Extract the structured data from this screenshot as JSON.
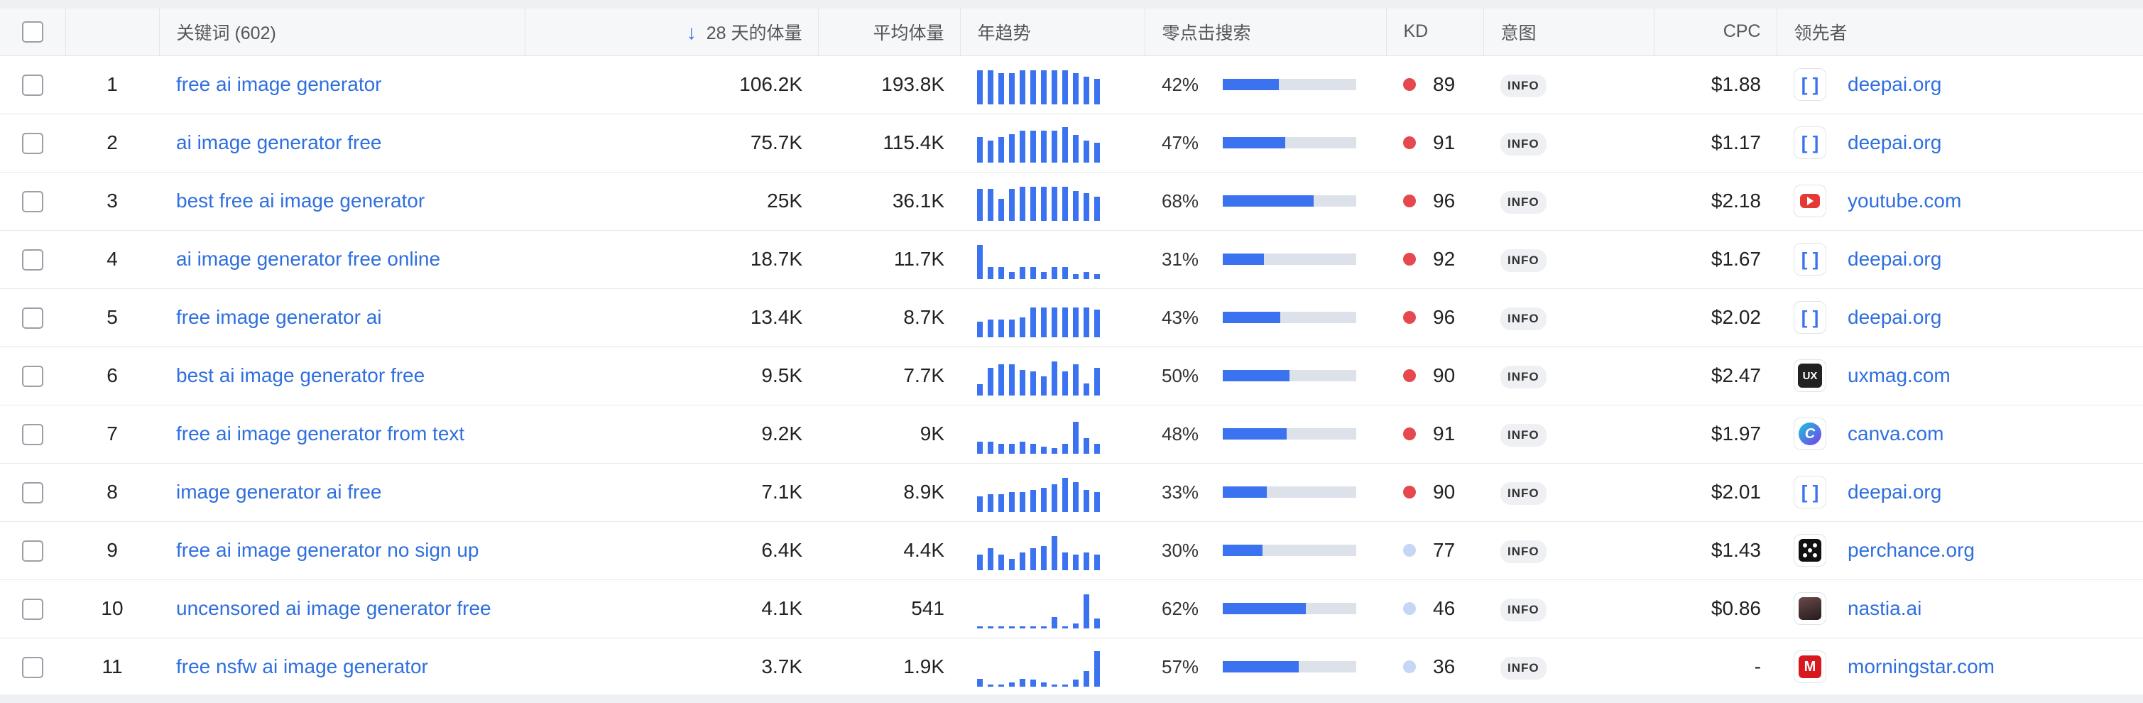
{
  "header": {
    "keyword": "关键词 (602)",
    "volume28": "28 天的体量",
    "avg_volume": "平均体量",
    "trend": "年趋势",
    "zero_click": "零点击搜索",
    "kd": "KD",
    "intent": "意图",
    "cpc": "CPC",
    "leader": "领先者"
  },
  "colors": {
    "accent": "#2f6fde",
    "bar": "#3a72f0",
    "kd_hard": "#e5484d",
    "kd_easy": "#c6d6f5"
  },
  "rows": [
    {
      "num": "1",
      "keyword": "free ai image generator",
      "vol28": "106.2K",
      "avg": "193.8K",
      "trend": [
        0.85,
        0.85,
        0.78,
        0.78,
        0.85,
        0.85,
        0.85,
        0.85,
        0.85,
        0.78,
        0.7,
        0.65
      ],
      "zero_pct": "42%",
      "zero": 0.42,
      "kd": "89",
      "kd_color": "#e5484d",
      "intent": "INFO",
      "cpc": "$1.88",
      "leader": "deepai.org",
      "leader_icon": "deepai-icon"
    },
    {
      "num": "2",
      "keyword": "ai image generator free",
      "vol28": "75.7K",
      "avg": "115.4K",
      "trend": [
        0.65,
        0.55,
        0.65,
        0.72,
        0.8,
        0.8,
        0.8,
        0.8,
        0.9,
        0.7,
        0.55,
        0.5
      ],
      "zero_pct": "47%",
      "zero": 0.47,
      "kd": "91",
      "kd_color": "#e5484d",
      "intent": "INFO",
      "cpc": "$1.17",
      "leader": "deepai.org",
      "leader_icon": "deepai-icon"
    },
    {
      "num": "3",
      "keyword": "best free ai image generator",
      "vol28": "25K",
      "avg": "36.1K",
      "trend": [
        0.8,
        0.8,
        0.55,
        0.8,
        0.85,
        0.85,
        0.85,
        0.85,
        0.85,
        0.75,
        0.7,
        0.6
      ],
      "zero_pct": "68%",
      "zero": 0.68,
      "kd": "96",
      "kd_color": "#e5484d",
      "intent": "INFO",
      "cpc": "$2.18",
      "leader": "youtube.com",
      "leader_icon": "youtube-icon"
    },
    {
      "num": "4",
      "keyword": "ai image generator free online",
      "vol28": "18.7K",
      "avg": "11.7K",
      "trend": [
        0.85,
        0.3,
        0.3,
        0.18,
        0.3,
        0.3,
        0.18,
        0.3,
        0.3,
        0.12,
        0.18,
        0.12
      ],
      "zero_pct": "31%",
      "zero": 0.31,
      "kd": "92",
      "kd_color": "#e5484d",
      "intent": "INFO",
      "cpc": "$1.67",
      "leader": "deepai.org",
      "leader_icon": "deepai-icon"
    },
    {
      "num": "5",
      "keyword": "free image generator ai",
      "vol28": "13.4K",
      "avg": "8.7K",
      "trend": [
        0.4,
        0.45,
        0.45,
        0.45,
        0.5,
        0.75,
        0.75,
        0.75,
        0.75,
        0.75,
        0.75,
        0.7
      ],
      "zero_pct": "43%",
      "zero": 0.43,
      "kd": "96",
      "kd_color": "#e5484d",
      "intent": "INFO",
      "cpc": "$2.02",
      "leader": "deepai.org",
      "leader_icon": "deepai-icon"
    },
    {
      "num": "6",
      "keyword": "best ai image generator free",
      "vol28": "9.5K",
      "avg": "7.7K",
      "trend": [
        0.28,
        0.7,
        0.78,
        0.78,
        0.65,
        0.6,
        0.48,
        0.85,
        0.6,
        0.78,
        0.3,
        0.7
      ],
      "zero_pct": "50%",
      "zero": 0.5,
      "kd": "90",
      "kd_color": "#e5484d",
      "intent": "INFO",
      "cpc": "$2.47",
      "leader": "uxmag.com",
      "leader_icon": "uxmag-icon"
    },
    {
      "num": "7",
      "keyword": "free ai image generator from text",
      "vol28": "9.2K",
      "avg": "9K",
      "trend": [
        0.3,
        0.3,
        0.25,
        0.25,
        0.3,
        0.25,
        0.18,
        0.15,
        0.25,
        0.8,
        0.4,
        0.25
      ],
      "zero_pct": "48%",
      "zero": 0.48,
      "kd": "91",
      "kd_color": "#e5484d",
      "intent": "INFO",
      "cpc": "$1.97",
      "leader": "canva.com",
      "leader_icon": "canva-icon"
    },
    {
      "num": "8",
      "keyword": "image generator ai free",
      "vol28": "7.1K",
      "avg": "8.9K",
      "trend": [
        0.4,
        0.45,
        0.45,
        0.5,
        0.5,
        0.55,
        0.6,
        0.7,
        0.85,
        0.75,
        0.55,
        0.5
      ],
      "zero_pct": "33%",
      "zero": 0.33,
      "kd": "90",
      "kd_color": "#e5484d",
      "intent": "INFO",
      "cpc": "$2.01",
      "leader": "deepai.org",
      "leader_icon": "deepai-icon"
    },
    {
      "num": "9",
      "keyword": "free ai image generator no sign up",
      "vol28": "6.4K",
      "avg": "4.4K",
      "trend": [
        0.4,
        0.55,
        0.4,
        0.28,
        0.45,
        0.55,
        0.6,
        0.85,
        0.45,
        0.4,
        0.45,
        0.4
      ],
      "zero_pct": "30%",
      "zero": 0.3,
      "kd": "77",
      "kd_color": "#c6d6f5",
      "intent": "INFO",
      "cpc": "$1.43",
      "leader": "perchance.org",
      "leader_icon": "dice-icon"
    },
    {
      "num": "10",
      "keyword": "uncensored ai image generator free",
      "vol28": "4.1K",
      "avg": "541",
      "trend": [
        0.05,
        0.05,
        0.05,
        0.05,
        0.05,
        0.05,
        0.05,
        0.28,
        0.05,
        0.12,
        0.85,
        0.25
      ],
      "zero_pct": "62%",
      "zero": 0.62,
      "kd": "46",
      "kd_color": "#c6d6f5",
      "intent": "INFO",
      "cpc": "$0.86",
      "leader": "nastia.ai",
      "leader_icon": "nastia-icon"
    },
    {
      "num": "11",
      "keyword": "free nsfw ai image generator",
      "vol28": "3.7K",
      "avg": "1.9K",
      "trend": [
        0.2,
        0.05,
        0.05,
        0.1,
        0.2,
        0.18,
        0.1,
        0.05,
        0.05,
        0.18,
        0.4,
        0.9
      ],
      "zero_pct": "57%",
      "zero": 0.57,
      "kd": "36",
      "kd_color": "#c6d6f5",
      "intent": "INFO",
      "cpc": "-",
      "leader": "morningstar.com",
      "leader_icon": "morningstar-icon"
    }
  ]
}
